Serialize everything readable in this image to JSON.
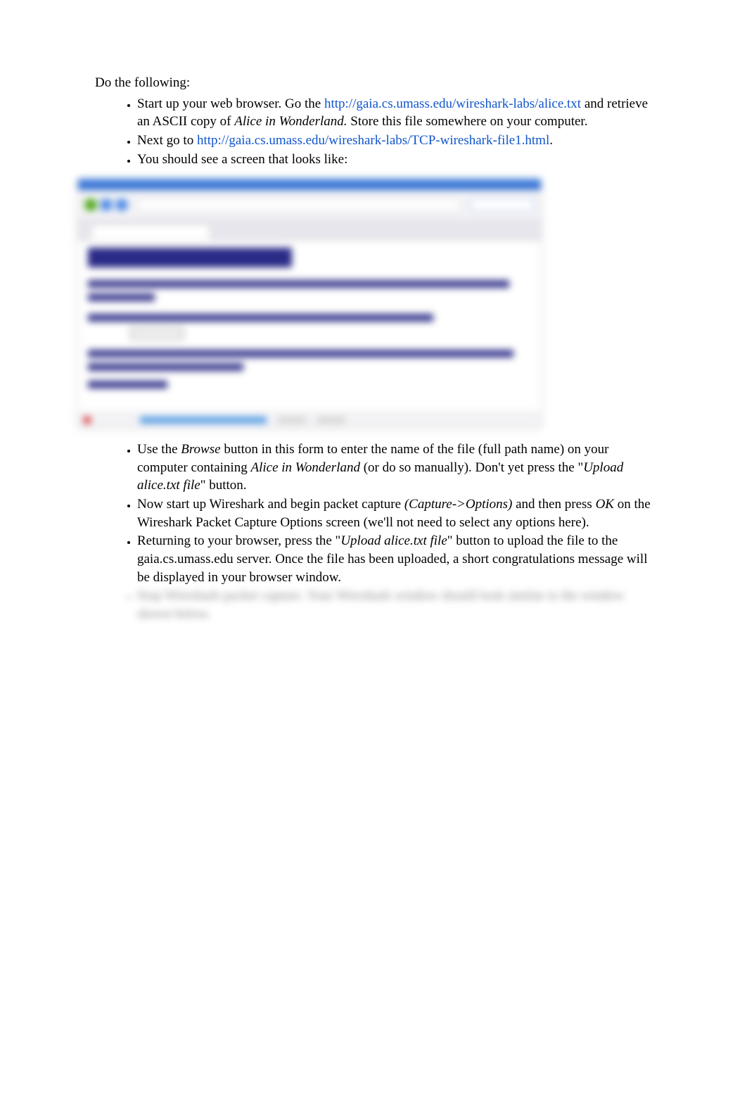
{
  "intro": "Do the following:",
  "list1": [
    {
      "pre": "Start up your web browser. Go the ",
      "link": "http://gaia.cs.umass.edu/wireshark-labs/alice.txt",
      "mid": " and retrieve an ASCII copy of ",
      "em": "Alice in Wonderland. ",
      "post": "Store this file somewhere on your computer."
    },
    {
      "pre": "Next go to   ",
      "link": "http://gaia.cs.umass.edu/wireshark-labs/TCP-wireshark-file1.html",
      "post": "."
    },
    {
      "text": "You should see a screen that looks like:"
    }
  ],
  "list2": [
    {
      "pre": "Use the ",
      "em1": "Browse",
      "mid1": " button in this form to enter the name of the file (full path name) on your computer containing ",
      "em2": "Alice in Wonderland",
      "mid2": " (or do so manually). Don't yet press the \"",
      "em3": "Upload alice.txt file",
      "post": "\" button."
    },
    {
      "pre": "Now start up Wireshark and begin packet capture ",
      "em1": "(Capture->Options)",
      "mid1": " and then press ",
      "em2": "OK",
      "post": " on the Wireshark Packet Capture Options screen (we'll not need to select any options here)."
    },
    {
      "pre": "Returning to your browser, press the \"",
      "em1": "Upload alice.txt file",
      "post": "\" button to upload the file to the gaia.cs.umass.edu server.  Once the file has been uploaded, a short congratulations message will be displayed in your browser window."
    }
  ],
  "blur_item": "Stop Wireshark packet capture. Your Wireshark window should look similar to the window shown below."
}
